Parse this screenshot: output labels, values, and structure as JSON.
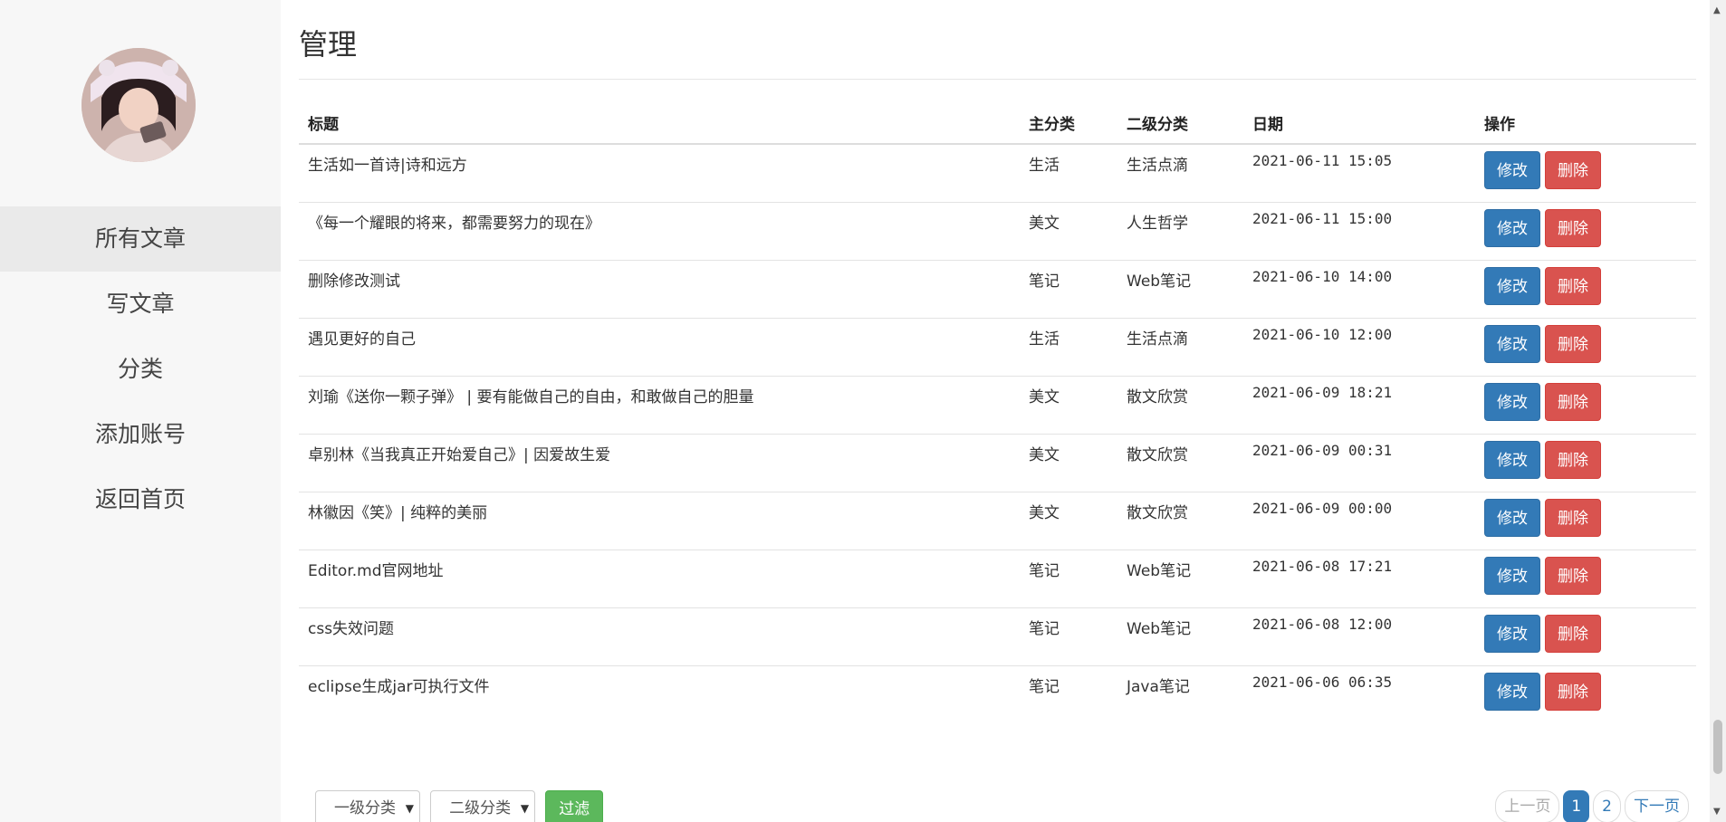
{
  "sidebar": {
    "nav": [
      "所有文章",
      "写文章",
      "分类",
      "添加账号",
      "返回首页"
    ],
    "active_index": 0
  },
  "page": {
    "title": "管理"
  },
  "table": {
    "headers": [
      "标题",
      "主分类",
      "二级分类",
      "日期",
      "操作"
    ],
    "rows": [
      {
        "title": "生活如一首诗|诗和远方",
        "main": "生活",
        "sub": "生活点滴",
        "date": "2021-06-11 15:05"
      },
      {
        "title": "《每一个耀眼的将来，都需要努力的现在》",
        "main": "美文",
        "sub": "人生哲学",
        "date": "2021-06-11 15:00"
      },
      {
        "title": "删除修改测试",
        "main": "笔记",
        "sub": "Web笔记",
        "date": "2021-06-10 14:00"
      },
      {
        "title": "遇见更好的自己",
        "main": "生活",
        "sub": "生活点滴",
        "date": "2021-06-10 12:00"
      },
      {
        "title": "刘瑜《送你一颗子弹》 | 要有能做自己的自由，和敢做自己的胆量",
        "main": "美文",
        "sub": "散文欣赏",
        "date": "2021-06-09 18:21"
      },
      {
        "title": "卓别林《当我真正开始爱自己》| 因爱故生爱",
        "main": "美文",
        "sub": "散文欣赏",
        "date": "2021-06-09 00:31"
      },
      {
        "title": "林徽因《笑》| 纯粹的美丽",
        "main": "美文",
        "sub": "散文欣赏",
        "date": "2021-06-09 00:00"
      },
      {
        "title": "Editor.md官网地址",
        "main": "笔记",
        "sub": "Web笔记",
        "date": "2021-06-08 17:21"
      },
      {
        "title": "css失效问题",
        "main": "笔记",
        "sub": "Web笔记",
        "date": "2021-06-08 12:00"
      },
      {
        "title": "eclipse生成jar可执行文件",
        "main": "笔记",
        "sub": "Java笔记",
        "date": "2021-06-06 06:35"
      }
    ],
    "edit_label": "修改",
    "delete_label": "删除"
  },
  "filter": {
    "level1": "一级分类",
    "level2": "二级分类",
    "button": "过滤"
  },
  "pagination": {
    "prev": "上一页",
    "pages": [
      "1",
      "2"
    ],
    "current": "1",
    "next": "下一页"
  },
  "colors": {
    "primary": "#337ab7",
    "danger": "#d9534f",
    "success": "#5cb85c",
    "sidebar_bg": "#f7f7f7",
    "active_nav_bg": "#eaeaea"
  }
}
